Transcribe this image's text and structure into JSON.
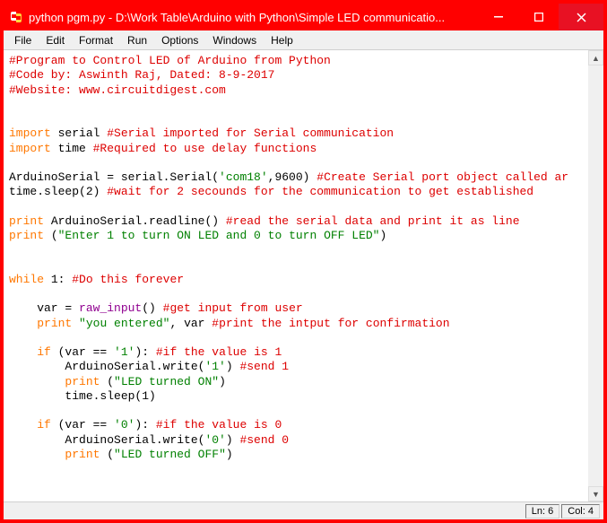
{
  "window": {
    "title": "python pgm.py - D:\\Work Table\\Arduino with Python\\Simple LED communicatio..."
  },
  "menu": {
    "file": "File",
    "edit": "Edit",
    "format": "Format",
    "run": "Run",
    "options": "Options",
    "windows": "Windows",
    "help": "Help"
  },
  "status": {
    "ln_label": "Ln: 6",
    "col_label": "Col: 4"
  },
  "code": {
    "l01": "#Program to Control LED of Arduino from Python",
    "l02": "#Code by: Aswinth Raj, Dated: 8-9-2017",
    "l03": "#Website: www.circuitdigest.com",
    "l04_kw": "import",
    "l04_rest": " serial ",
    "l04_c": "#Serial imported for Serial communication",
    "l05_kw": "import",
    "l05_rest": " time ",
    "l05_c": "#Required to use delay functions",
    "l06a": "ArduinoSerial = serial.Serial(",
    "l06s": "'com18'",
    "l06b": ",9600) ",
    "l06c": "#Create Serial port object called ar",
    "l07a": "time.sleep(2) ",
    "l07c": "#wait for 2 secounds for the communication to get established",
    "l08_kw": "print",
    "l08_rest": " ArduinoSerial.readline() ",
    "l08_c": "#read the serial data and print it as line",
    "l09_kw": "print",
    "l09_rest": " (",
    "l09_s": "\"Enter 1 to turn ON LED and 0 to turn OFF LED\"",
    "l09_end": ")",
    "l10_kw": "while",
    "l10_rest": " 1: ",
    "l10_c": "#Do this forever",
    "l11a": "    var = ",
    "l11_fn": "raw_input",
    "l11b": "() ",
    "l11_c": "#get input from user",
    "l12_indent": "    ",
    "l12_kw": "print",
    "l12_sp": " ",
    "l12_s": "\"you entered\"",
    "l12_rest": ", var ",
    "l12_c": "#print the intput for confirmation",
    "l13_indent": "    ",
    "l13_kw": "if",
    "l13_rest": " (var == ",
    "l13_s": "'1'",
    "l13_end": "): ",
    "l13_c": "#if the value is 1",
    "l14a": "        ArduinoSerial.write(",
    "l14_s": "'1'",
    "l14b": ") ",
    "l14_c": "#send 1",
    "l15_indent": "        ",
    "l15_kw": "print",
    "l15_rest": " (",
    "l15_s": "\"LED turned ON\"",
    "l15_end": ")",
    "l16": "        time.sleep(1)",
    "l17_indent": "    ",
    "l17_kw": "if",
    "l17_rest": " (var == ",
    "l17_s": "'0'",
    "l17_end": "): ",
    "l17_c": "#if the value is 0",
    "l18a": "        ArduinoSerial.write(",
    "l18_s": "'0'",
    "l18b": ") ",
    "l18_c": "#send 0",
    "l19_indent": "        ",
    "l19_kw": "print",
    "l19_rest": " (",
    "l19_s": "\"LED turned OFF\"",
    "l19_end": ")"
  }
}
